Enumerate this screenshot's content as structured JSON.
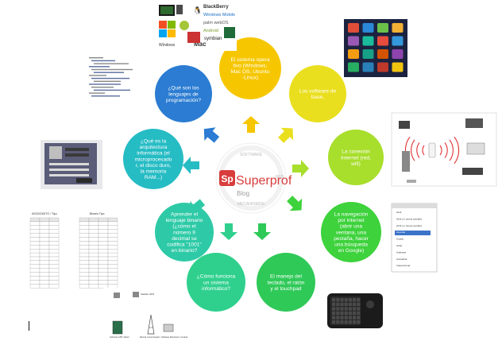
{
  "logo": {
    "mark": "Sp",
    "word": "Superprof",
    "sub": "Blog"
  },
  "center_labels": [
    "SOFTWARE",
    "RED",
    "MECANISMOS"
  ],
  "nodes": [
    {
      "id": "sistema-operativo",
      "color": "#f6c700",
      "text": [
        "El sistema opera",
        "tivo (Windows,",
        "Mac OS, Ubuntu",
        "-Linux)"
      ]
    },
    {
      "id": "software-base",
      "color": "#eadf1e",
      "text": [
        "Los software de",
        "base,"
      ]
    },
    {
      "id": "conexion-internet",
      "color": "#a8de2c",
      "text": [
        "La conexión",
        "Internet (red,",
        "wifi)"
      ]
    },
    {
      "id": "navegacion-internet",
      "color": "#3ed23c",
      "text": [
        "La navegación",
        "por internet",
        "(abrir una",
        "ventana, una",
        "pestaña, hacer",
        "una búsqueda",
        "en Google)"
      ]
    },
    {
      "id": "manejo-teclado",
      "color": "#2fc958",
      "text": [
        "El manejo del",
        "teclado, el ratón",
        "y el touchpad"
      ]
    },
    {
      "id": "sistema-informatico",
      "color": "#2fd08e",
      "text": [
        "¿Cómo funciona",
        "un sistema",
        "informático?"
      ]
    },
    {
      "id": "lenguaje-binario",
      "color": "#2ecaa7",
      "text": [
        "Aprender el",
        "lenguaje binario",
        "(¿cómo el",
        "número 9",
        "decimal se",
        "codifica \"1001\"",
        "en binario?"
      ]
    },
    {
      "id": "arquitectura-informatica",
      "color": "#26bcc4",
      "text": [
        "¿Qué es la",
        "arquitectura",
        "informática (el",
        "microprocesado",
        "r, el disco duro,",
        "la memoria",
        "RAM...)"
      ]
    },
    {
      "id": "lenguajes-programacion",
      "color": "#2b7cd2",
      "text": [
        "¿Qué son los",
        "lenguajes de",
        "programación?"
      ]
    }
  ],
  "thumbnails": {
    "os_logos": {
      "labels": [
        "BlackBerry",
        "Windows Mobile",
        "palm webOS",
        "Android",
        "Mac",
        "symbian"
      ]
    },
    "binary_table": {
      "headers": [
        "DECIMAL",
        "BINARIO",
        "HEXA"
      ],
      "title_left": "ASCII/DIGITO / Tipo",
      "title_right": "Binario Tipo"
    },
    "network": {
      "labels": [
        "Satélite GPS",
        "Vehículo GPS / Móvil",
        "Red de Comunicación",
        "Software Monitoreo / Central"
      ]
    },
    "browser_menu": {
      "items": [
        "Abrir",
        "Abrir en nueva pestaña",
        "Abrir en nueva ventana",
        "Guardar",
        "Copiar",
        "Atrás",
        "Adelante",
        "Actualizar",
        "Inspeccionar"
      ]
    }
  },
  "colors": {
    "background": "#ffffff",
    "logo_red": "#d93c3c",
    "logo_ring": "#e0e0e0"
  }
}
